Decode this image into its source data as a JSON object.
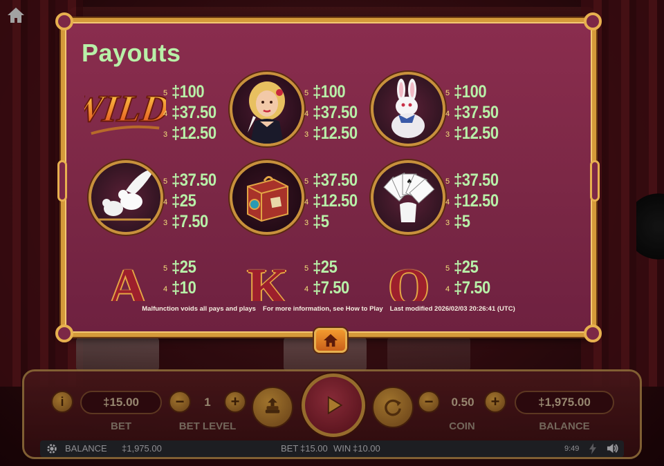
{
  "paytable": {
    "title": "Payouts",
    "symbols": [
      {
        "name": "Wild",
        "pays": [
          {
            "count": "5",
            "value": "‡100"
          },
          {
            "count": "4",
            "value": "‡37.50"
          },
          {
            "count": "3",
            "value": "‡12.50"
          }
        ]
      },
      {
        "name": "Magician Assistant",
        "pays": [
          {
            "count": "5",
            "value": "‡100"
          },
          {
            "count": "4",
            "value": "‡37.50"
          },
          {
            "count": "3",
            "value": "‡12.50"
          }
        ]
      },
      {
        "name": "Rabbit",
        "pays": [
          {
            "count": "5",
            "value": "‡100"
          },
          {
            "count": "4",
            "value": "‡37.50"
          },
          {
            "count": "3",
            "value": "‡12.50"
          }
        ]
      },
      {
        "name": "Doves",
        "pays": [
          {
            "count": "5",
            "value": "‡37.50"
          },
          {
            "count": "4",
            "value": "‡25"
          },
          {
            "count": "3",
            "value": "‡7.50"
          }
        ]
      },
      {
        "name": "Magic Box",
        "pays": [
          {
            "count": "5",
            "value": "‡37.50"
          },
          {
            "count": "4",
            "value": "‡12.50"
          },
          {
            "count": "3",
            "value": "‡5"
          }
        ]
      },
      {
        "name": "Cards",
        "pays": [
          {
            "count": "5",
            "value": "‡37.50"
          },
          {
            "count": "4",
            "value": "‡12.50"
          },
          {
            "count": "3",
            "value": "‡5"
          }
        ]
      },
      {
        "name": "A",
        "pays": [
          {
            "count": "5",
            "value": "‡25"
          },
          {
            "count": "4",
            "value": "‡10"
          }
        ]
      },
      {
        "name": "K",
        "pays": [
          {
            "count": "5",
            "value": "‡25"
          },
          {
            "count": "4",
            "value": "‡7.50"
          }
        ]
      },
      {
        "name": "Q",
        "pays": [
          {
            "count": "5",
            "value": "‡25"
          },
          {
            "count": "4",
            "value": "‡7.50"
          }
        ]
      }
    ],
    "wild_label": "WILD",
    "letters": {
      "a": "A",
      "k": "K",
      "q": "Q"
    },
    "footer": {
      "malfunction": "Malfunction voids all pays and plays",
      "more_info": "For more information, see How to Play",
      "last_modified": "Last modified 2026/02/03 20:26:41 (UTC)"
    }
  },
  "controls": {
    "bet_value": "‡15.00",
    "bet_label": "BET",
    "bet_level_value": "1",
    "bet_level_label": "BET LEVEL",
    "coin_value": "0.50",
    "coin_label": "COIN",
    "balance_value": "‡1,975.00",
    "balance_label": "BALANCE",
    "info_glyph": "i",
    "minus_glyph": "−",
    "plus_glyph": "+"
  },
  "status_bar": {
    "balance_label": "BALANCE",
    "balance_value": "‡1,975.00",
    "bet_label": "BET",
    "bet_value": "‡15.00",
    "win_label": "WIN",
    "win_value": "‡10.00",
    "time": "9:49"
  },
  "colors": {
    "accent_green": "#b8f0a8",
    "gold": "#d49a3a",
    "panel": "#7c2846"
  },
  "icons": [
    "home-icon",
    "info-icon",
    "autoplay-icon",
    "spin-icon",
    "turbo-icon",
    "settings-icon",
    "sound-icon",
    "lightning-icon"
  ]
}
